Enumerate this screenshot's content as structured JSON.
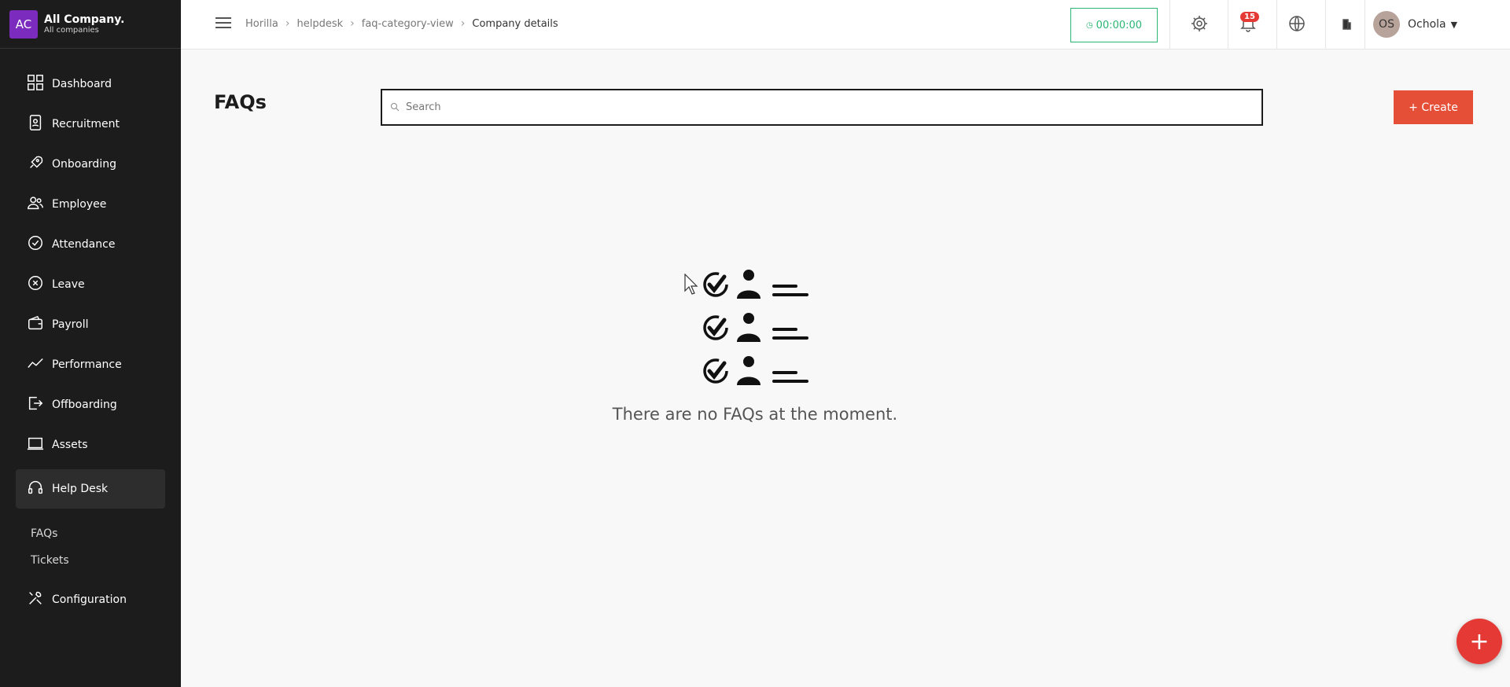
{
  "company": {
    "initials": "AC",
    "name": "All Company.",
    "subtitle": "All companies"
  },
  "sidebar": {
    "items": [
      {
        "label": "Dashboard",
        "icon": "dashboard-icon"
      },
      {
        "label": "Recruitment",
        "icon": "recruitment-icon"
      },
      {
        "label": "Onboarding",
        "icon": "rocket-icon"
      },
      {
        "label": "Employee",
        "icon": "users-icon"
      },
      {
        "label": "Attendance",
        "icon": "check-circle-icon"
      },
      {
        "label": "Leave",
        "icon": "x-circle-icon"
      },
      {
        "label": "Payroll",
        "icon": "wallet-icon"
      },
      {
        "label": "Performance",
        "icon": "trend-icon"
      },
      {
        "label": "Offboarding",
        "icon": "exit-icon"
      },
      {
        "label": "Assets",
        "icon": "laptop-icon"
      },
      {
        "label": "Help Desk",
        "icon": "headset-icon",
        "active": true
      }
    ],
    "subitems": [
      {
        "label": "FAQs"
      },
      {
        "label": "Tickets"
      }
    ],
    "configuration": {
      "label": "Configuration",
      "icon": "tools-icon"
    }
  },
  "topbar": {
    "breadcrumb": [
      "Horilla",
      "helpdesk",
      "faq-category-view",
      "Company details"
    ],
    "timer": "00:00:00",
    "notification_count": "15",
    "user": {
      "initials": "OS",
      "name": "Ochola"
    }
  },
  "main": {
    "title": "FAQs",
    "search_placeholder": "Search",
    "create_label": "+ Create",
    "empty_message": "There are no FAQs at the moment.",
    "fab_label": "+"
  },
  "colors": {
    "accent": "#e54f38",
    "timer": "#2bb673",
    "sidebar": "#1c1c1c",
    "company_badge": "#7b2bbd"
  }
}
